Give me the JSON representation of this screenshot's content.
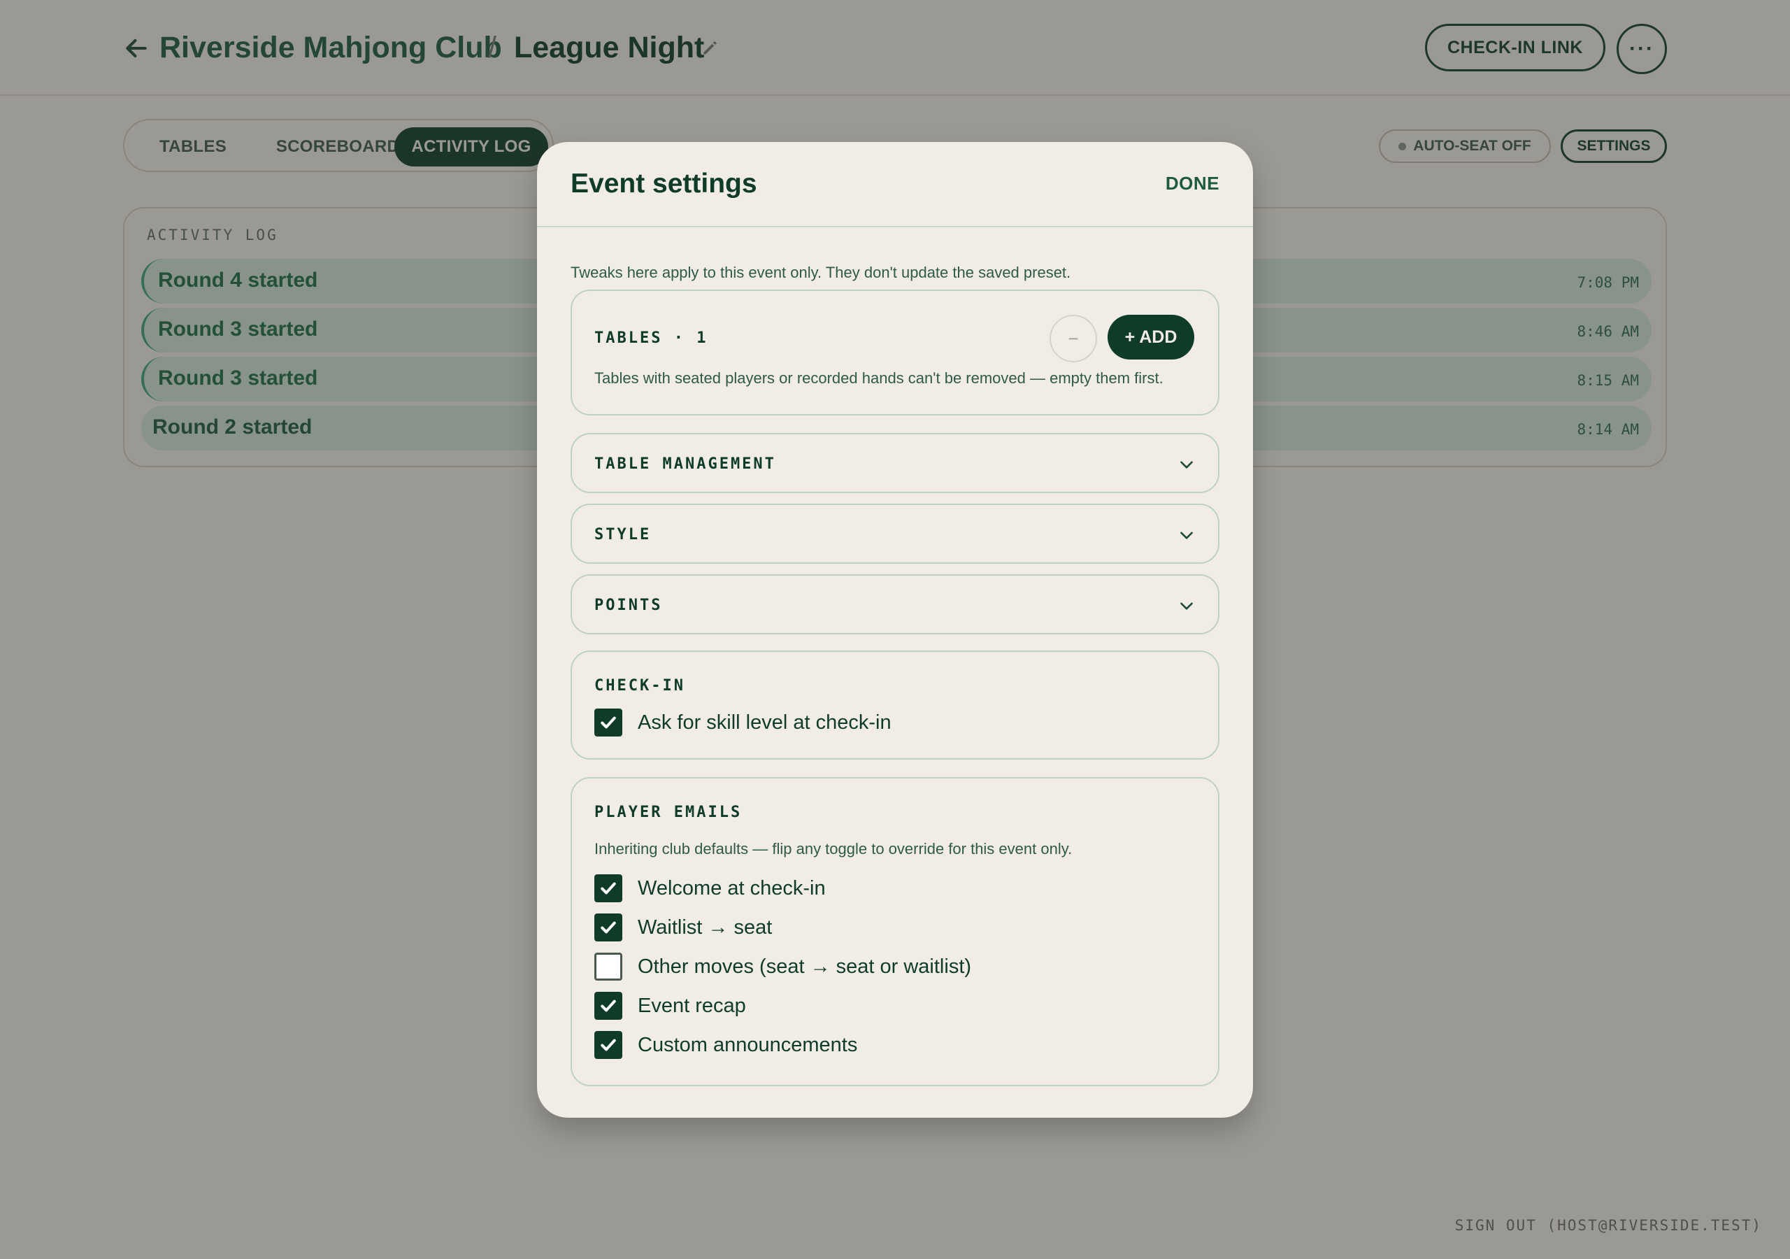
{
  "header": {
    "club": "Riverside Mahjong Club",
    "separator": "/",
    "event": "League Night",
    "checkin_link_label": "CHECK-IN LINK",
    "more_label": "···"
  },
  "tabs": [
    {
      "label": "TABLES",
      "active": false
    },
    {
      "label": "SCOREBOARD",
      "active": false
    },
    {
      "label": "ACTIVITY LOG",
      "active": true
    }
  ],
  "toolbar": {
    "autoseat_label": "AUTO-SEAT OFF",
    "settings_label": "SETTINGS"
  },
  "activity_log": {
    "title": "ACTIVITY LOG",
    "rows": [
      {
        "text": "Round 4 started",
        "time": "7:08 PM"
      },
      {
        "text": "Round 3 started",
        "time": "8:46 AM"
      },
      {
        "text": "Round 3 started",
        "time": "8:15 AM"
      },
      {
        "text": "Round 2 started",
        "time": "8:14 AM"
      }
    ]
  },
  "footer": {
    "signout": "SIGN OUT (HOST@RIVERSIDE.TEST)"
  },
  "modal": {
    "title": "Event settings",
    "done_label": "DONE",
    "note": "Tweaks here apply to this event only. They don't update the saved preset.",
    "tables": {
      "label": "TABLES · 1",
      "minus_label": "−",
      "add_label": "+ ADD",
      "help": "Tables with seated players or recorded hands can't be removed — empty them first."
    },
    "sections": {
      "table_management": "TABLE MANAGEMENT",
      "style": "STYLE",
      "points": "POINTS"
    },
    "checkin": {
      "label": "CHECK-IN",
      "options": [
        {
          "label": "Ask for skill level at check-in",
          "checked": true
        }
      ]
    },
    "emails": {
      "label": "PLAYER EMAILS",
      "help": "Inheriting club defaults — flip any toggle to override for this event only.",
      "options": [
        {
          "label": "Welcome at check-in",
          "checked": true
        },
        {
          "label": "Waitlist → seat",
          "checked": true
        },
        {
          "label": "Other moves (seat → seat or waitlist)",
          "checked": false
        },
        {
          "label": "Event recap",
          "checked": true
        },
        {
          "label": "Custom announcements",
          "checked": true
        }
      ]
    }
  },
  "colors": {
    "brand_dark": "#0f3b29",
    "brand_text": "#1d5a40",
    "surface": "#f1ede6",
    "log_row": "#cfe3d7",
    "overlay": "rgba(45,45,40,0.44)"
  }
}
